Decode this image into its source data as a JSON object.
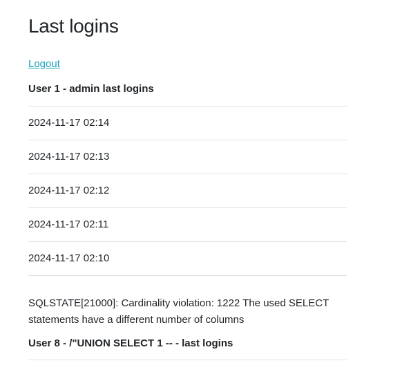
{
  "page": {
    "title": "Last logins",
    "logout_label": "Logout"
  },
  "user1": {
    "heading": "User 1 - admin last logins",
    "logins": [
      "2024-11-17 02:14",
      "2024-11-17 02:13",
      "2024-11-17 02:12",
      "2024-11-17 02:11",
      "2024-11-17 02:10"
    ]
  },
  "error": {
    "message": "SQLSTATE[21000]: Cardinality violation: 1222 The used SELECT statements have a different number of columns"
  },
  "user8": {
    "heading": "User 8 - /\"UNION SELECT 1 -- - last logins"
  },
  "colors": {
    "link": "#17a2b8",
    "text": "#212529",
    "divider": "#dee2e6"
  }
}
